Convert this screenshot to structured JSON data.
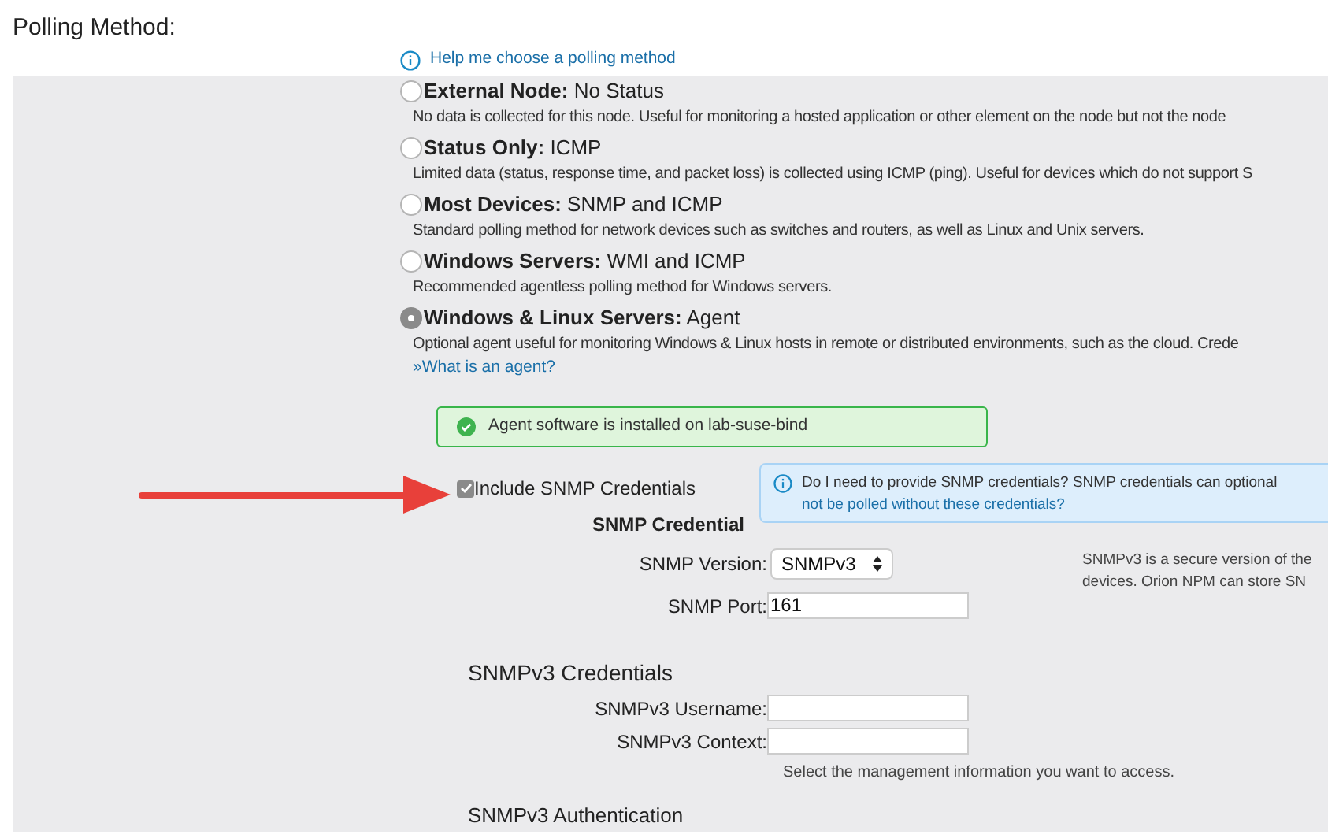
{
  "heading": "Polling Method:",
  "help_link": "Help me choose a polling method",
  "options": [
    {
      "title": "External Node:",
      "value": "No Status",
      "description": "No data is collected for this node. Useful for monitoring a hosted application or other element on the node but not the node",
      "selected": false
    },
    {
      "title": "Status Only:",
      "value": "ICMP",
      "description": "Limited data (status, response time, and packet loss) is collected using ICMP (ping). Useful for devices which do not support S",
      "selected": false
    },
    {
      "title": "Most Devices:",
      "value": "SNMP and ICMP",
      "description": "Standard polling method for network devices such as switches and routers, as well as Linux and Unix servers.",
      "selected": false
    },
    {
      "title": "Windows Servers:",
      "value": "WMI and ICMP",
      "description": "Recommended agentless polling method for Windows servers.",
      "selected": false
    },
    {
      "title": "Windows & Linux Servers:",
      "value": "Agent",
      "description": "Optional agent useful for monitoring Windows & Linux hosts in remote or distributed environments, such as the cloud. Crede",
      "selected": true,
      "link": "»What is an agent?"
    }
  ],
  "success_message": "Agent software is installed on lab-suse-bind",
  "include_snmp": {
    "label": "Include SNMP Credentials",
    "checked": true
  },
  "info": {
    "text": "Do I need to provide SNMP credentials? SNMP credentials can optional",
    "link": "not be polled without these credentials?"
  },
  "snmp_credential": {
    "title": "SNMP Credential",
    "version_label": "SNMP Version:",
    "version_value": "SNMPv3",
    "version_note": [
      "SNMPv3 is a secure version of the",
      "devices. Orion NPM can store SN"
    ],
    "port_label": "SNMP Port:",
    "port_value": "161"
  },
  "snmpv3": {
    "title": "SNMPv3 Credentials",
    "username_label": "SNMPv3 Username:",
    "context_label": "SNMPv3 Context:",
    "context_hint": "Select the management information you want to access.",
    "auth_title": "SNMPv3 Authentication"
  }
}
